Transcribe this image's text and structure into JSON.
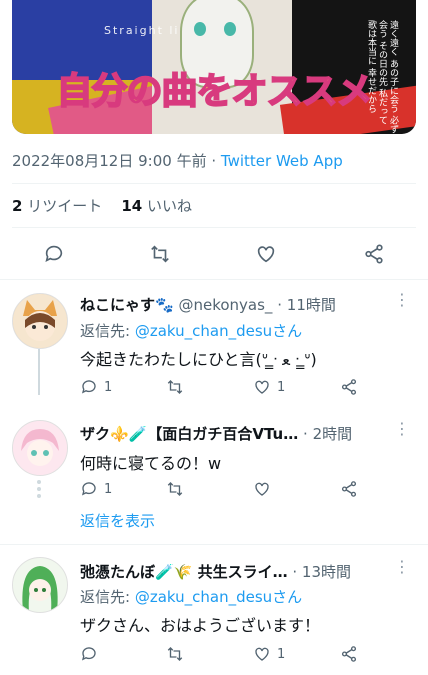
{
  "tweet": {
    "banner": {
      "headline": "自分の曲をオススメ",
      "left_title": "Straight li",
      "right_vertical": "遠く遠く あの子に会う 必ず会う その日の先 私だって 歌は本当に 幸せだから"
    },
    "timestamp": "2022年08月12日 9:00 午前",
    "separator": "·",
    "source": "Twitter Web App",
    "stats": {
      "retweet_count": "2",
      "retweet_label": "リツイート",
      "like_count": "14",
      "like_label": "いいね"
    },
    "actions": [
      "reply-icon",
      "retweet-icon",
      "like-icon",
      "share-icon"
    ]
  },
  "replies": [
    {
      "name": "ねこにゃす🐾",
      "handle": "@nekonyas_",
      "sep": "·",
      "time": "11時間",
      "reply_to_prefix": "返信先: ",
      "reply_to": "@zaku_chan_desuさん",
      "text": "今起きたわたしにひと言(ᐡ ̳ᐧ ﻌ ᐧ ̳ᐡ)",
      "reply_count": "1",
      "retweet_count": "",
      "like_count": "1"
    },
    {
      "name": "ザク⚜️🧪【面白ガチ百合VTu…",
      "handle": "",
      "sep": "·",
      "time": "2時間",
      "text": "何時に寝てるの！w",
      "reply_count": "1",
      "retweet_count": "",
      "like_count": ""
    },
    {
      "name": "弛憑たんぼ🧪🌾 共生スライ…",
      "handle": "",
      "sep": "·",
      "time": "13時間",
      "reply_to_prefix": "返信先: ",
      "reply_to": "@zaku_chan_desuさん",
      "text": "ザクさん、おはようございます！",
      "reply_count": "",
      "retweet_count": "",
      "like_count": "1"
    }
  ],
  "show_replies_label": "返信を表示",
  "colors": {
    "accent": "#1d9bf0",
    "muted": "#536471",
    "text": "#0f1419"
  }
}
